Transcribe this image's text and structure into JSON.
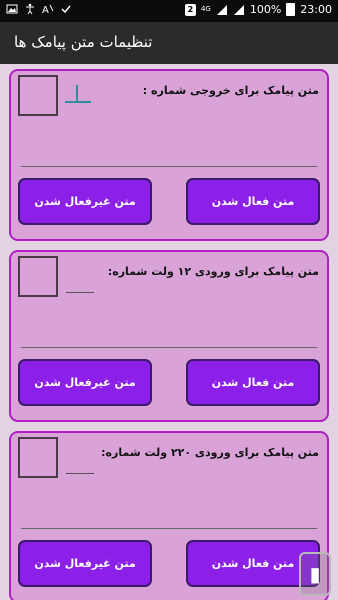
{
  "status_bar": {
    "battery": "100%",
    "time": "23:00",
    "sim": "2",
    "network": "4G"
  },
  "app_bar": {
    "title": "تنظیمات متن پیامک ها"
  },
  "cards": [
    {
      "label": "متن پیامک برای خروجی شماره :",
      "activate_label": "متن فعال شدن",
      "deactivate_label": "متن غیرفعال شدن",
      "cursor_icon": "text-cursor-icon"
    },
    {
      "label": "متن پیامک برای ورودی ۱۲ ولت شماره:",
      "activate_label": "متن فعال شدن",
      "deactivate_label": "متن غیرفعال شدن"
    },
    {
      "label": "متن پیامک برای ورودی ۲۲۰ ولت شماره:",
      "activate_label": "متن فعال شدن",
      "deactivate_label": "متن غیرفعال شدن"
    }
  ],
  "colors": {
    "card_bg": "#d9a3d8",
    "card_border": "#b01fc4",
    "button_bg": "#8c1fe8",
    "app_bar_bg": "#2b2b2b",
    "page_bg": "#e2d2e2"
  }
}
